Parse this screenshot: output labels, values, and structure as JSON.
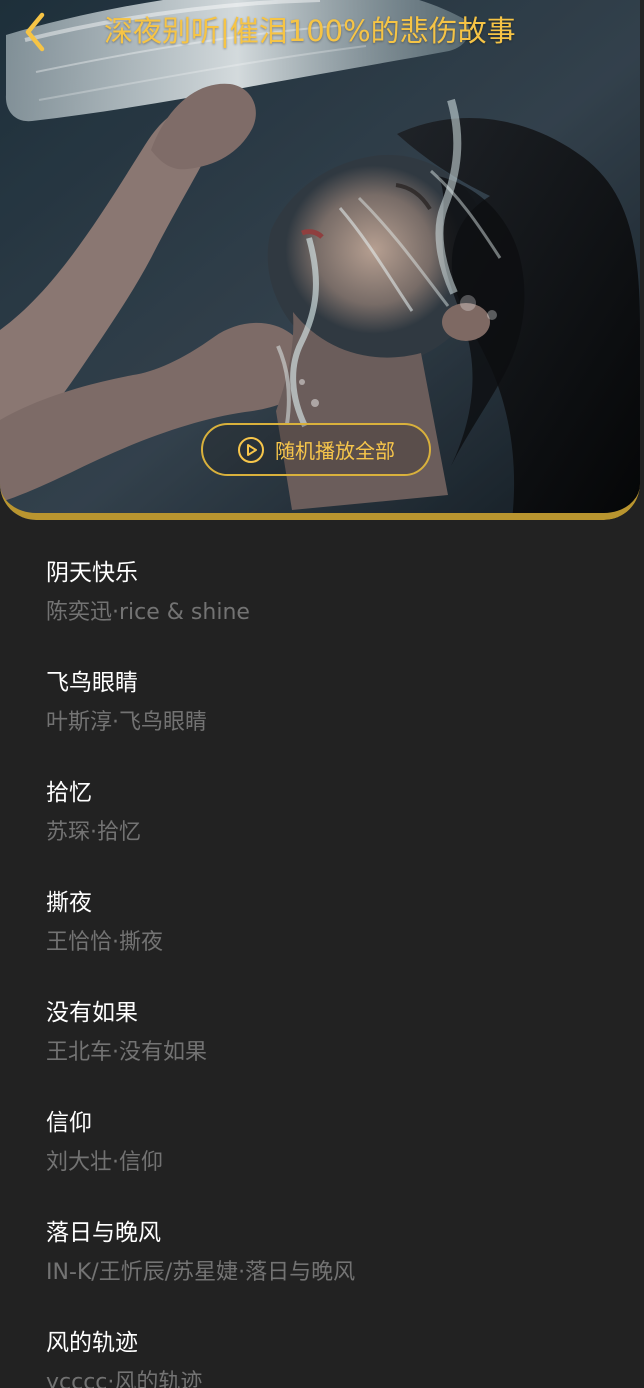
{
  "header": {
    "title": "深夜别听|催泪100%的悲伤故事",
    "back_icon": "chevron-left-icon",
    "accent_color": "#f6c445",
    "border_color": "#b9952f"
  },
  "cover": {
    "play_all_label": "随机播放全部",
    "play_icon": "play-circle-icon"
  },
  "songs": [
    {
      "title": "阴天快乐",
      "meta": "陈奕迅·rice & shine"
    },
    {
      "title": "飞鸟眼睛",
      "meta": "叶斯淳·飞鸟眼睛"
    },
    {
      "title": "拾忆",
      "meta": "苏琛·拾忆"
    },
    {
      "title": "撕夜",
      "meta": "王恰恰·撕夜"
    },
    {
      "title": "没有如果",
      "meta": "王北车·没有如果"
    },
    {
      "title": "信仰",
      "meta": "刘大壮·信仰"
    },
    {
      "title": "落日与晚风",
      "meta": "IN-K/王忻辰/苏星婕·落日与晚风"
    },
    {
      "title": "风的轨迹",
      "meta": "ycccc·风的轨迹"
    }
  ],
  "colors": {
    "background": "#222222",
    "song_title": "#ffffff",
    "song_meta": "#737373"
  }
}
